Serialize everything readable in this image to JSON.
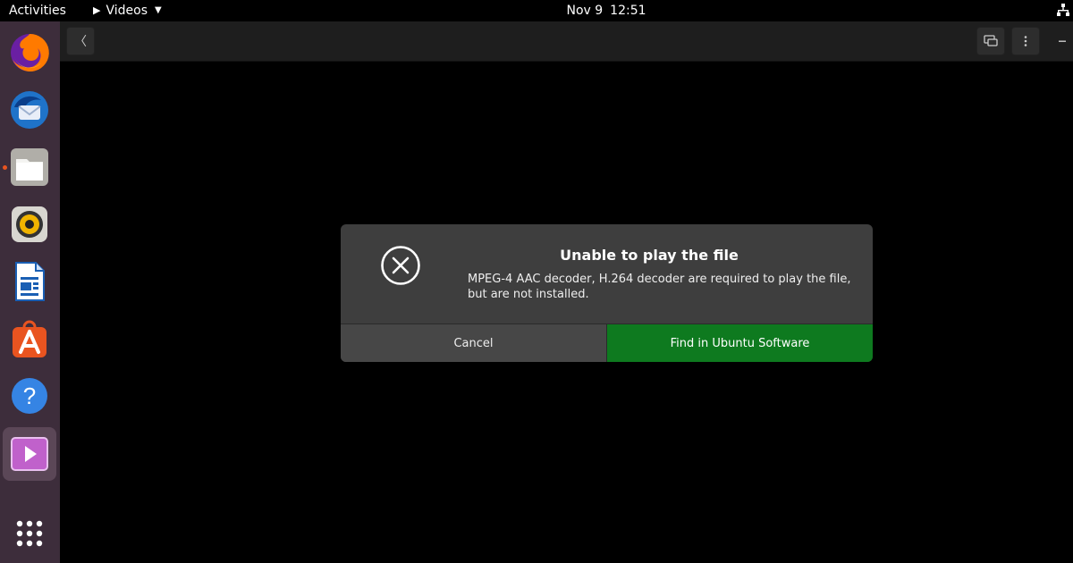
{
  "topbar": {
    "activities": "Activities",
    "app_name": "Videos",
    "date": "Nov 9",
    "time": "12:51"
  },
  "dock": {
    "items": [
      {
        "name": "firefox-icon",
        "running": false
      },
      {
        "name": "thunderbird-icon",
        "running": false
      },
      {
        "name": "files-icon",
        "running": true
      },
      {
        "name": "rhythmbox-icon",
        "running": false
      },
      {
        "name": "libreoffice-writer-icon",
        "running": false
      },
      {
        "name": "ubuntu-software-icon",
        "running": false
      },
      {
        "name": "help-icon",
        "running": false
      },
      {
        "name": "videos-icon",
        "running": true,
        "active": true
      },
      {
        "name": "show-applications-icon",
        "running": false
      }
    ]
  },
  "headerbar": {
    "back_icon": "chevron-left-icon",
    "display_icon": "screen-icon",
    "menu_icon": "vertical-dots-icon"
  },
  "dialog": {
    "title": "Unable to play the file",
    "message": "MPEG-4 AAC decoder, H.264 decoder are required to play the file, but are not installed.",
    "cancel_label": "Cancel",
    "find_label": "Find in Ubuntu Software",
    "find_color": "#0e7a1f"
  }
}
